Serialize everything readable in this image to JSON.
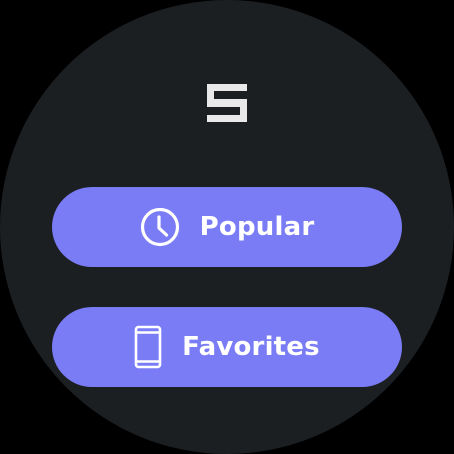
{
  "app": {
    "logo_icon": "brand-logo-icon",
    "background_color": "#1c1f22",
    "accent_color": "#7a7cf5"
  },
  "menu": {
    "items": [
      {
        "label": "Popular",
        "icon": "clock-icon"
      },
      {
        "label": "Favorites",
        "icon": "phone-icon"
      }
    ]
  }
}
